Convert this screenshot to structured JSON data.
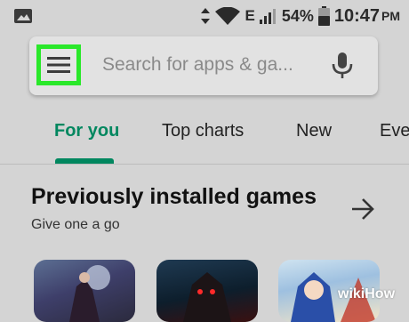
{
  "status_bar": {
    "battery_percent": "54%",
    "network": "E",
    "time": "10:47",
    "ampm": "PM",
    "icons": [
      "image-icon",
      "data-arrows-icon",
      "wifi-icon",
      "signal-icon",
      "battery-icon"
    ]
  },
  "search": {
    "placeholder": "Search for apps & ga...",
    "menu_icon": "hamburger-menu-icon",
    "mic_icon": "microphone-icon",
    "highlight_color": "#2ae82a"
  },
  "tabs": [
    {
      "label": "For you",
      "active": true
    },
    {
      "label": "Top charts",
      "active": false
    },
    {
      "label": "New",
      "active": false
    },
    {
      "label": "Eve",
      "active": false
    }
  ],
  "accent_color": "#01875f",
  "section": {
    "title": "Previously installed games",
    "subtitle": "Give one a go",
    "arrow_icon": "arrow-right-icon"
  },
  "watermark": {
    "wiki": "wiki",
    "how": "How"
  }
}
